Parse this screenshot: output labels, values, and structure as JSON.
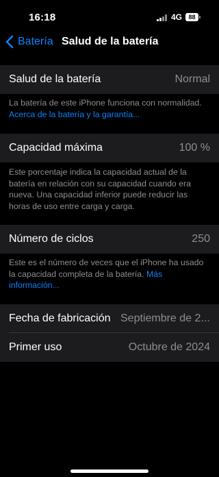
{
  "status": {
    "time": "16:18",
    "network": "4G",
    "battery": "88"
  },
  "nav": {
    "back_label": "Batería",
    "title": "Salud de la batería"
  },
  "health": {
    "label": "Salud de la batería",
    "value": "Normal",
    "description": "La batería de este iPhone funciona con normalidad.",
    "link": "Acerca de la batería y la garantía..."
  },
  "capacity": {
    "label": "Capacidad máxima",
    "value": "100 %",
    "description": "Este porcentaje indica la capacidad actual de la batería en relación con su capacidad cuando era nueva. Una capacidad inferior puede reducir las horas de uso entre carga y carga."
  },
  "cycles": {
    "label": "Número de ciclos",
    "value": "250",
    "description": "Este es el número de veces que el iPhone ha usado la capacidad completa de la batería.",
    "link": "Más información..."
  },
  "manufacture": {
    "label": "Fecha de fabricación",
    "value": "Septiembre de 2..."
  },
  "first_use": {
    "label": "Primer uso",
    "value": "Octubre de 2024"
  },
  "icons": {
    "back": "chevron-left-icon",
    "signal": "cellular-signal-icon",
    "battery": "battery-icon"
  },
  "colors": {
    "accent": "#0a84ff",
    "background": "#000000",
    "cell": "#1c1c1e",
    "secondary_text": "#8e8e93"
  }
}
